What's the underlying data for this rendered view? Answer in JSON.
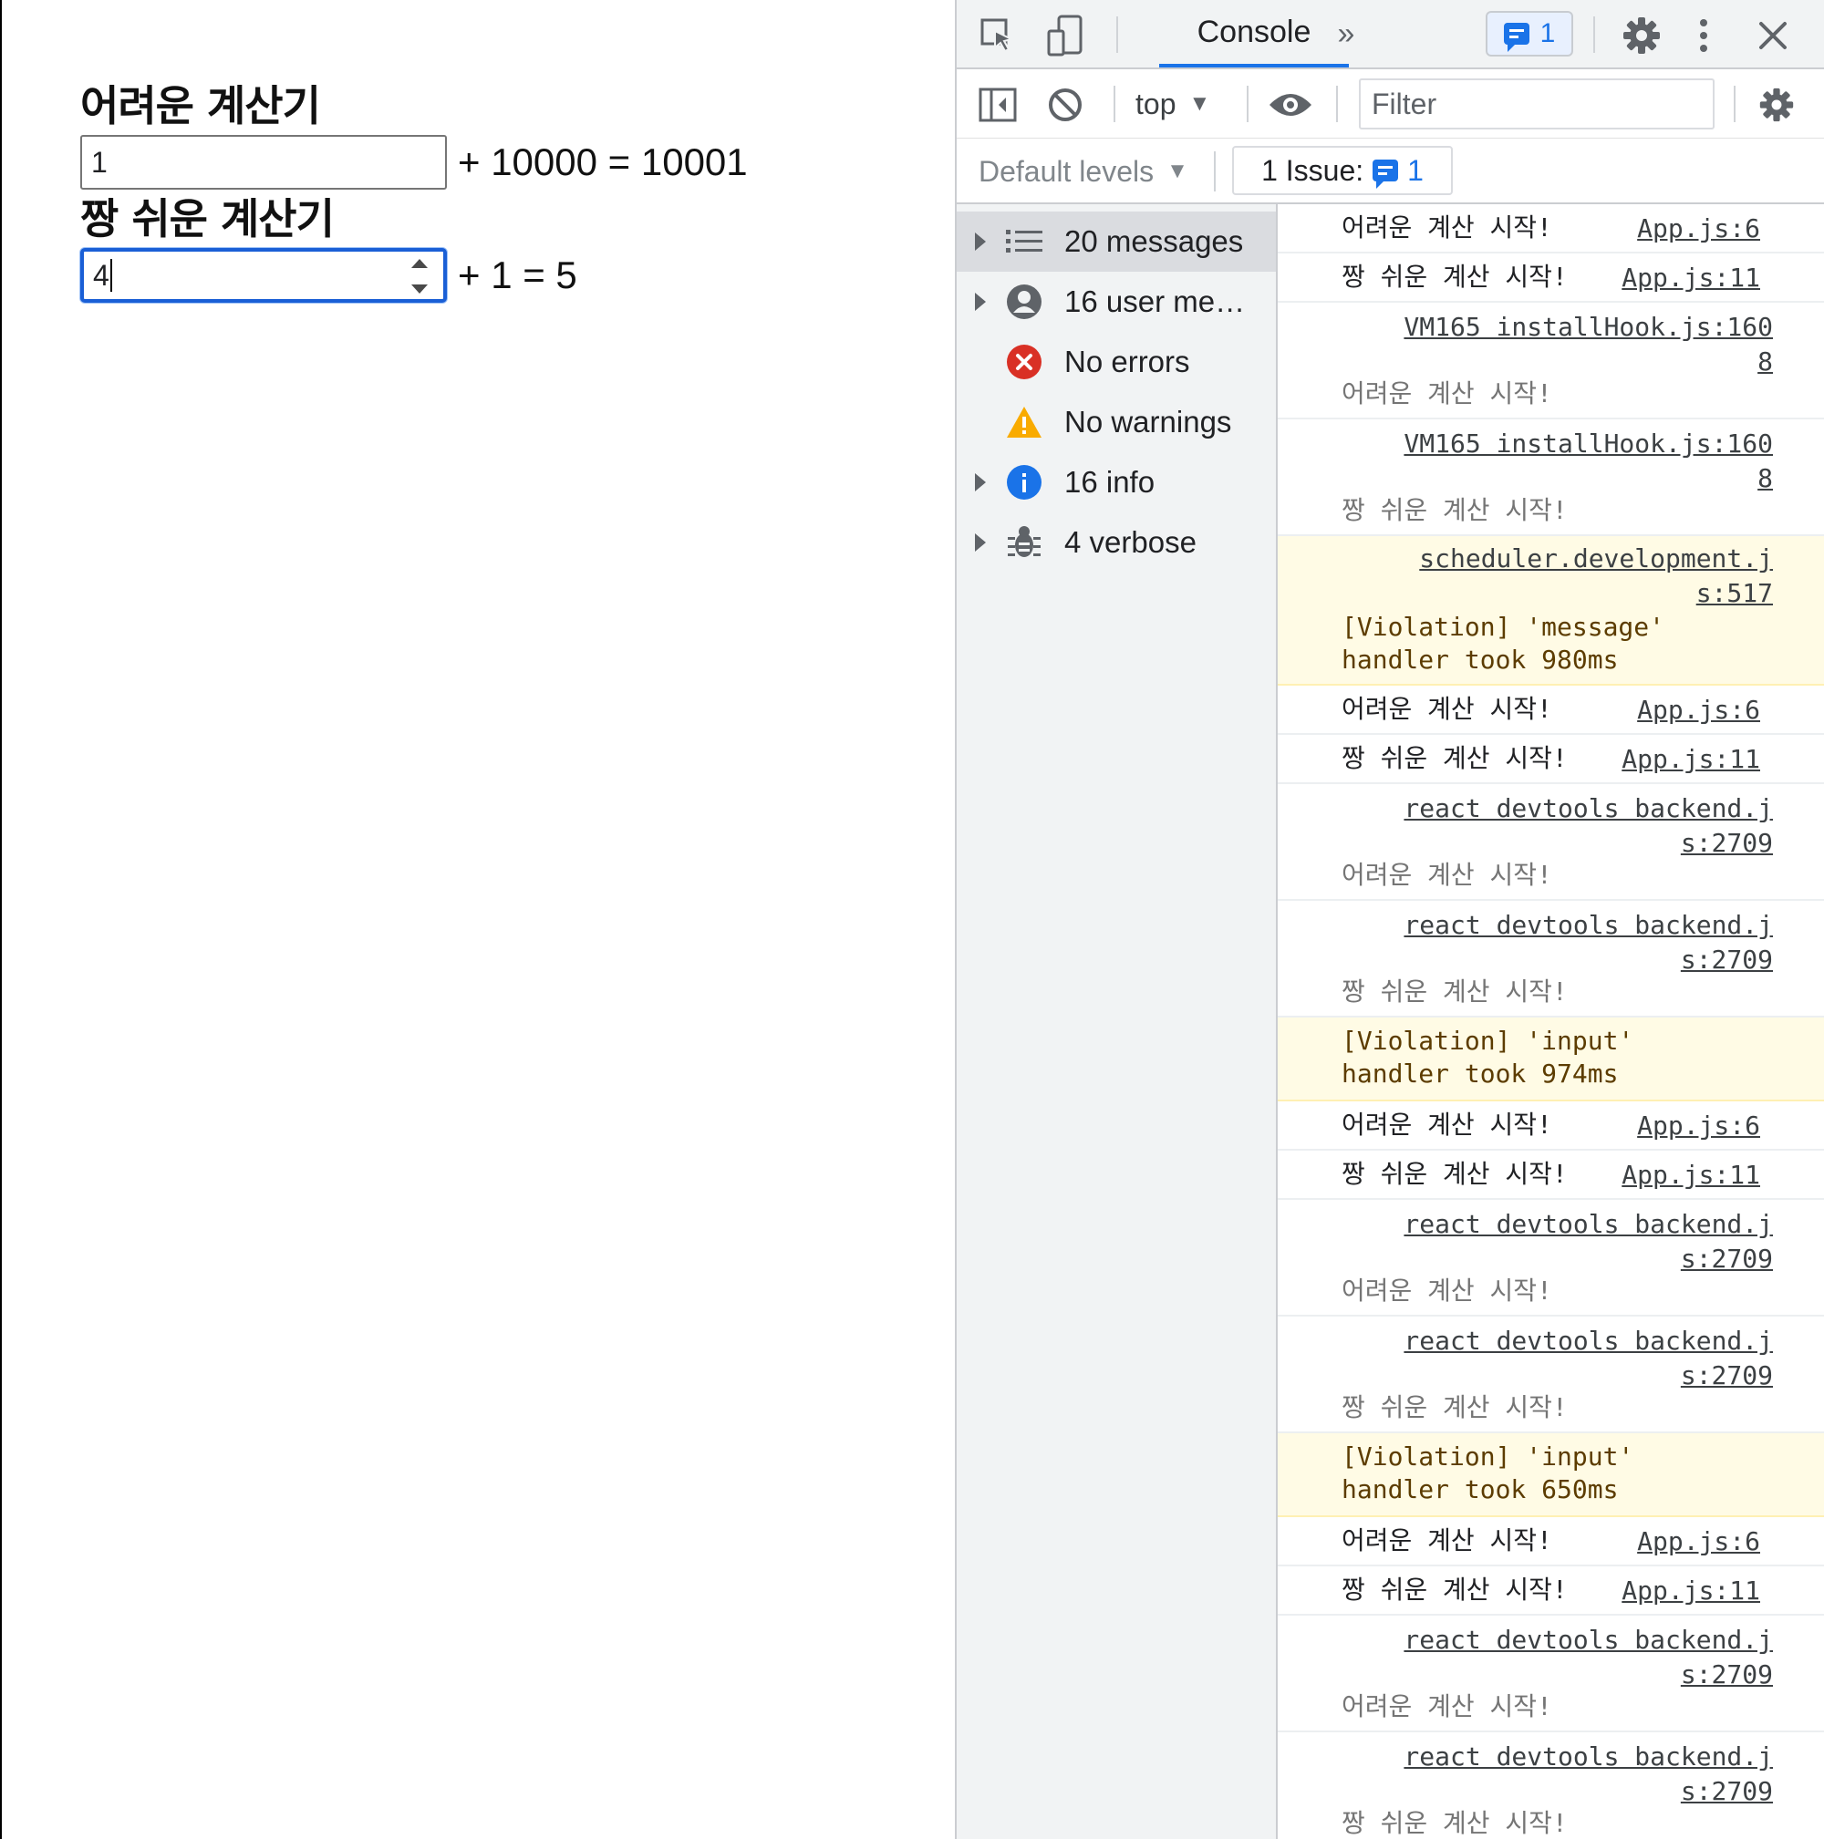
{
  "page": {
    "calc_hard": {
      "title": "어려운 계산기",
      "input_value": "1",
      "expression": "+ 10000 = 10001"
    },
    "calc_easy": {
      "title": "짱 쉬운 계산기",
      "input_value": "4",
      "expression": "+ 1 = 5"
    }
  },
  "devtools": {
    "tabs": {
      "console_label": "Console",
      "more_label": "»"
    },
    "issue_badge_count": "1",
    "context": "top",
    "filter_placeholder": "Filter",
    "levels_label": "Default levels",
    "issues_label": "1 Issue:",
    "issues_count": "1",
    "accent_color": "#1a73e8",
    "sidebar": {
      "items": [
        {
          "label": "20 messages",
          "icon": "list-icon"
        },
        {
          "label": "16 user me…",
          "icon": "user-icon"
        },
        {
          "label": "No errors",
          "icon": "error-icon"
        },
        {
          "label": "No warnings",
          "icon": "warning-icon"
        },
        {
          "label": "16 info",
          "icon": "info-icon"
        },
        {
          "label": "4 verbose",
          "icon": "bug-icon"
        }
      ]
    },
    "messages": [
      {
        "text": "어려운 계산 시작!",
        "source": "App.js:6"
      },
      {
        "text": "짱 쉬운 계산 시작!",
        "source": "App.js:11"
      },
      {
        "text": "어려운 계산 시작!",
        "source": "VM165 installHook.js:160\n8"
      },
      {
        "text": "짱 쉬운 계산 시작!",
        "source": "VM165 installHook.js:160\n8"
      },
      {
        "text": "[Violation] 'message'\nhandler took 980ms",
        "source": "scheduler.development.j\ns:517"
      },
      {
        "text": "어려운 계산 시작!",
        "source": "App.js:6"
      },
      {
        "text": "짱 쉬운 계산 시작!",
        "source": "App.js:11"
      },
      {
        "text": "어려운 계산 시작!",
        "source": "react devtools backend.j\ns:2709"
      },
      {
        "text": "짱 쉬운 계산 시작!",
        "source": "react devtools backend.j\ns:2709"
      },
      {
        "text": "[Violation] 'input'\nhandler took 974ms"
      },
      {
        "text": "어려운 계산 시작!",
        "source": "App.js:6"
      },
      {
        "text": "짱 쉬운 계산 시작!",
        "source": "App.js:11"
      },
      {
        "text": "어려운 계산 시작!",
        "source": "react devtools backend.j\ns:2709"
      },
      {
        "text": "짱 쉬운 계산 시작!",
        "source": "react devtools backend.j\ns:2709"
      },
      {
        "text": "[Violation] 'input'\nhandler took 650ms"
      },
      {
        "text": "어려운 계산 시작!",
        "source": "App.js:6"
      },
      {
        "text": "짱 쉬운 계산 시작!",
        "source": "App.js:11"
      },
      {
        "text": "어려운 계산 시작!",
        "source": "react devtools backend.j\ns:2709"
      },
      {
        "text": "짱 쉬운 계산 시작!",
        "source": "react devtools backend.j\ns:2709"
      }
    ]
  }
}
